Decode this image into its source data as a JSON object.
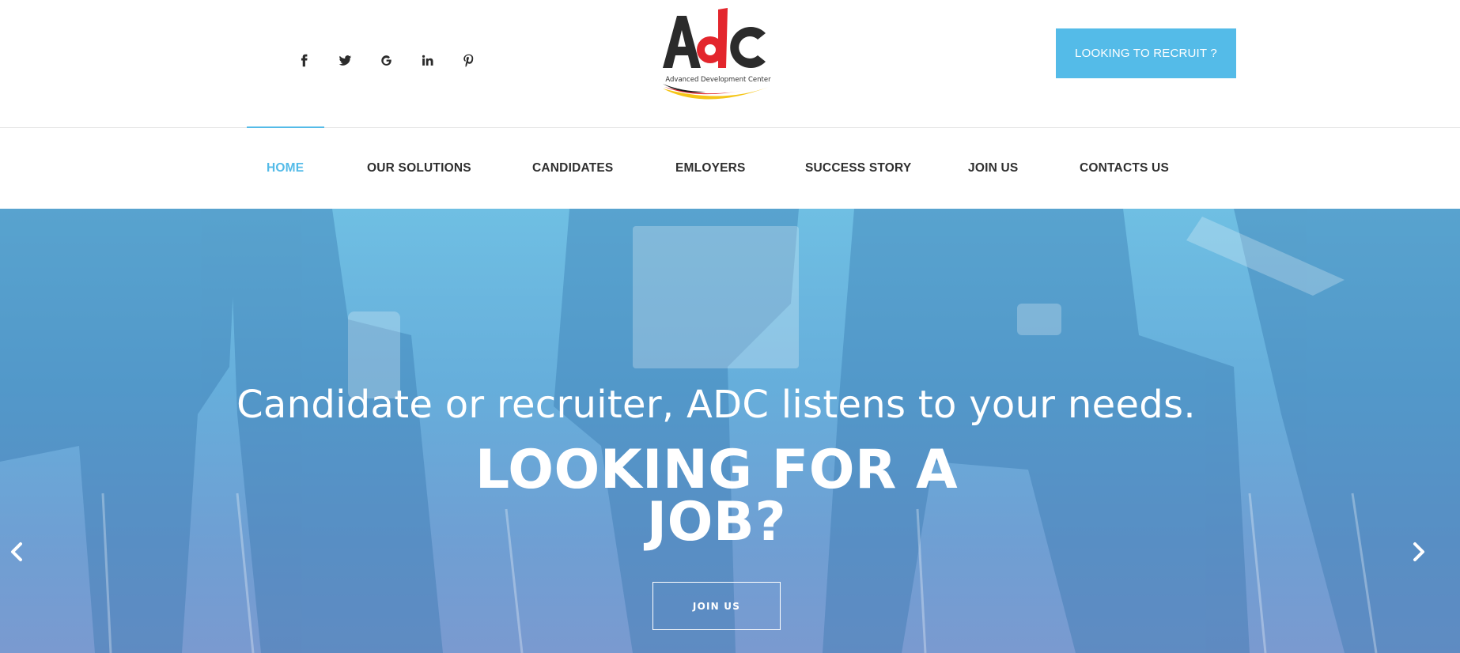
{
  "header": {
    "social": [
      {
        "icon": "facebook-icon",
        "glyph": "f"
      },
      {
        "icon": "twitter-icon",
        "glyph": ""
      },
      {
        "icon": "google-icon",
        "glyph": "G"
      },
      {
        "icon": "linkedin-icon",
        "glyph": "in"
      },
      {
        "icon": "pinterest-icon",
        "glyph": ""
      }
    ],
    "logo": {
      "text": "AdC",
      "tagline": "Advanced Development Center"
    },
    "recruit_button": "LOOKING TO RECRUIT ?"
  },
  "nav": {
    "items": [
      {
        "label": "HOME",
        "active": true
      },
      {
        "label": "OUR SOLUTIONS"
      },
      {
        "label": "CANDIDATES"
      },
      {
        "label": "EMLOYERS"
      },
      {
        "label": "SUCCESS STORY"
      },
      {
        "label": "JOIN US"
      },
      {
        "label": "CONTACTS US"
      }
    ]
  },
  "hero": {
    "subtitle": "Candidate or recruiter, ADC listens to your needs.",
    "title": "LOOKING FOR A JOB?",
    "button": "JOIN US",
    "prev_icon": "chevron-left-icon",
    "next_icon": "chevron-right-icon"
  },
  "colors": {
    "accent": "#54bbe8",
    "nav_text": "#2f2f2f",
    "logo_red": "#e3262d",
    "logo_yellow": "#f5c518"
  }
}
